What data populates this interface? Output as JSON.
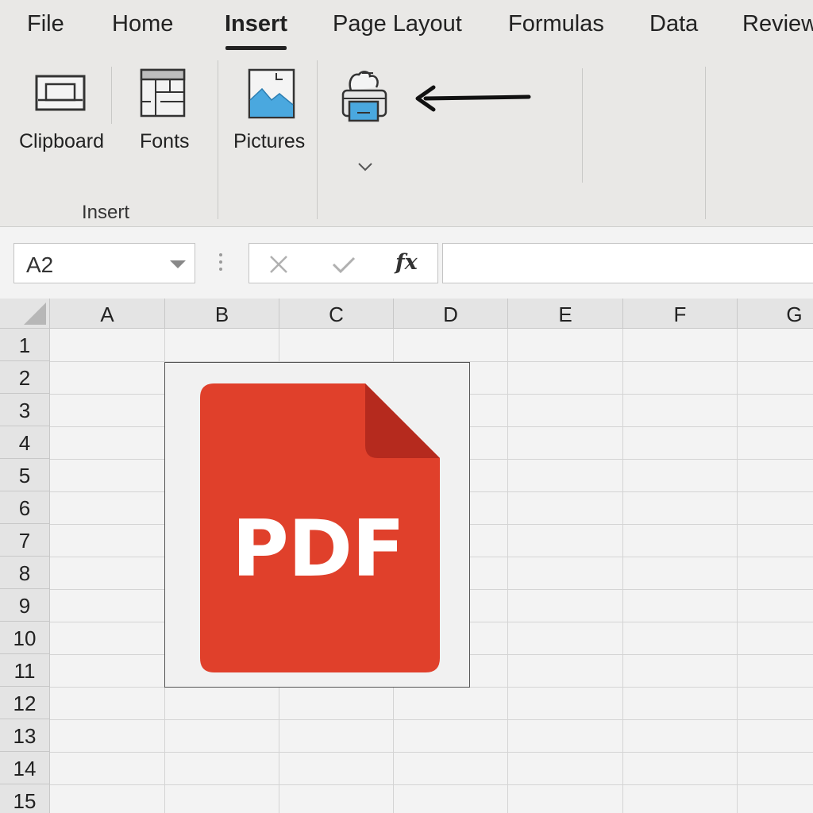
{
  "menu": {
    "tabs": [
      {
        "label": "File"
      },
      {
        "label": "Home"
      },
      {
        "label": "Insert"
      },
      {
        "label": "Page Layout"
      },
      {
        "label": "Formulas"
      },
      {
        "label": "Data"
      },
      {
        "label": "Review"
      }
    ],
    "active_tab": "Insert"
  },
  "ribbon": {
    "clipboard_label": "Clipboard",
    "fonts_label": "Fonts",
    "pictures_label": "Pictures",
    "group_label": "Insert",
    "icons": {
      "clipboard": "laptop-icon",
      "fonts": "table-grid-icon",
      "pictures": "image-icon",
      "printer": "printer-icon",
      "arrow": "arrow-left-icon",
      "dropdown": "chevron-down-icon"
    }
  },
  "formula_bar": {
    "name_box_value": "A2",
    "function_label": "fx",
    "formula_value": ""
  },
  "grid": {
    "columns": [
      "A",
      "B",
      "C",
      "D",
      "E",
      "F",
      "G"
    ],
    "rows": [
      "1",
      "2",
      "3",
      "4",
      "5",
      "6",
      "7",
      "8",
      "9",
      "10",
      "11",
      "12",
      "13",
      "14",
      "15"
    ]
  },
  "embedded_object": {
    "label": "PDF",
    "color": "#e0402b",
    "fold_color": "#b52a1e"
  },
  "colors": {
    "ribbon_bg": "#e9e8e6",
    "picture_blue": "#4aa8df"
  }
}
